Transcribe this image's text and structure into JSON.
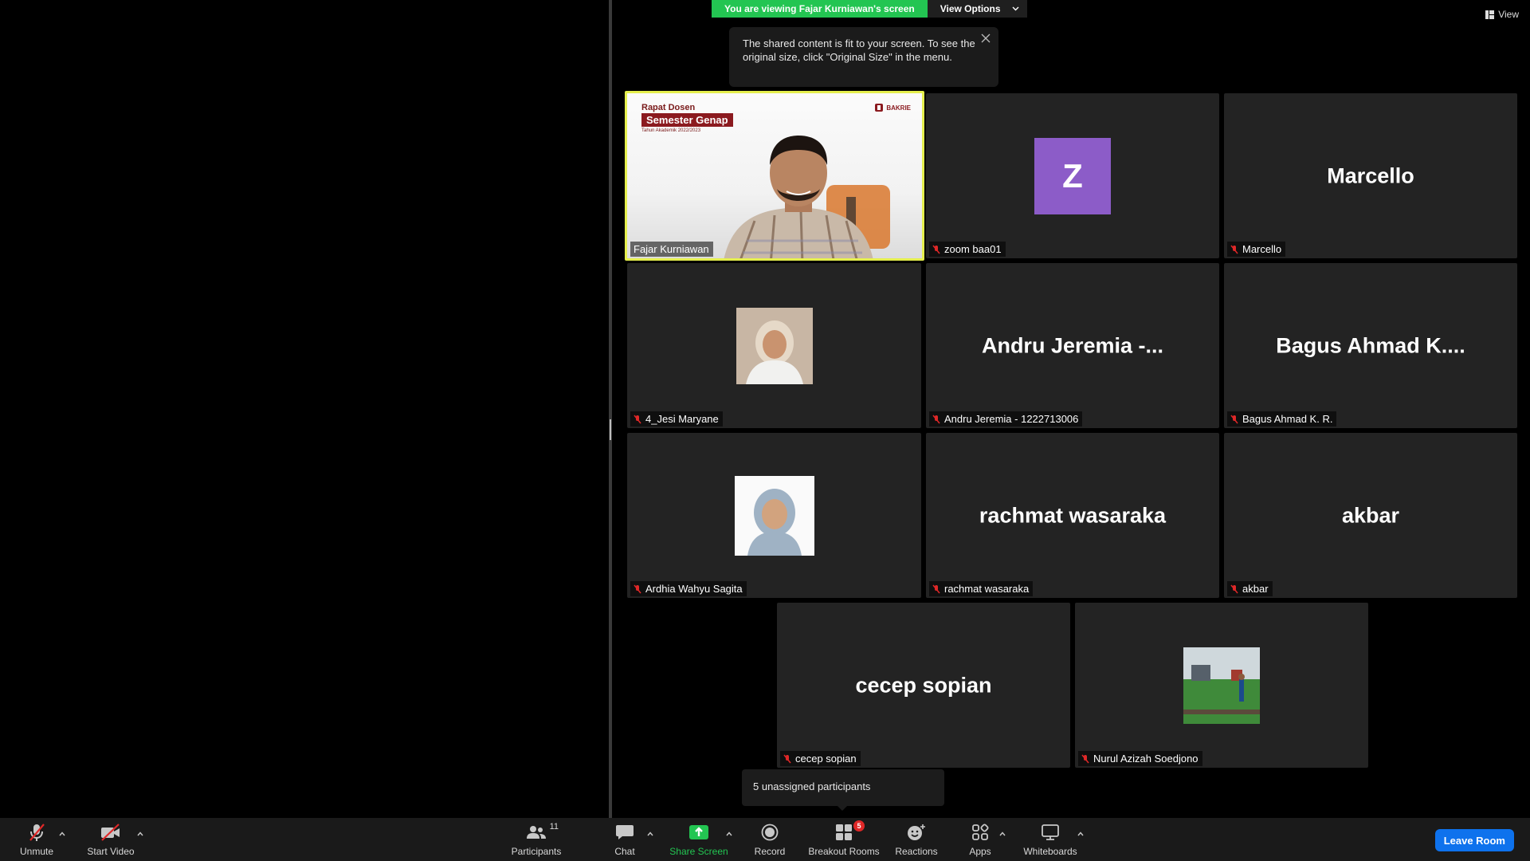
{
  "banner": {
    "viewing_text": "You are viewing Fajar Kurniawan's screen",
    "view_options_label": "View Options"
  },
  "tooltip": {
    "text": "The shared content is fit to your screen. To see the original size, click \"Original Size\" in the menu."
  },
  "view_label": "View",
  "speaker_slide": {
    "title": "Rapat Dosen",
    "tag": "Semester Genap",
    "subtitle": "Tahun Akademik 2022/2023",
    "logo_text": "BAKRIE"
  },
  "participants": [
    {
      "display": "",
      "name": "Fajar Kurniawan",
      "type": "video"
    },
    {
      "display": "Z",
      "name": "zoom baa01",
      "type": "letter"
    },
    {
      "display": "Marcello",
      "name": "Marcello",
      "type": "name"
    },
    {
      "display": "",
      "name": "4_Jesi Maryane",
      "type": "photo"
    },
    {
      "display": "Andru Jeremia -...",
      "name": "Andru Jeremia - 1222713006",
      "type": "name"
    },
    {
      "display": "Bagus Ahmad K....",
      "name": "Bagus Ahmad K. R.",
      "type": "name"
    },
    {
      "display": "",
      "name": "Ardhia Wahyu Sagita",
      "type": "photo"
    },
    {
      "display": "rachmat wasaraka",
      "name": "rachmat wasaraka",
      "type": "name"
    },
    {
      "display": "akbar",
      "name": "akbar",
      "type": "name"
    },
    {
      "display": "cecep sopian",
      "name": "cecep sopian",
      "type": "name"
    },
    {
      "display": "",
      "name": "Nurul Azizah Soedjono",
      "type": "photo"
    }
  ],
  "unassigned_text": "5 unassigned participants",
  "toolbar": {
    "unmute": "Unmute",
    "start_video": "Start Video",
    "participants": "Participants",
    "participants_count": "11",
    "chat": "Chat",
    "share_screen": "Share Screen",
    "record": "Record",
    "breakout_rooms": "Breakout Rooms",
    "breakout_badge": "5",
    "reactions": "Reactions",
    "apps": "Apps",
    "whiteboards": "Whiteboards",
    "leave_room": "Leave Room"
  },
  "colors": {
    "banner_green": "#23c552",
    "active_speaker_border": "#e5ef4d",
    "leave_blue": "#0e72ed",
    "muted_red": "#e02828",
    "avatar_purple": "#8c5cc8"
  }
}
